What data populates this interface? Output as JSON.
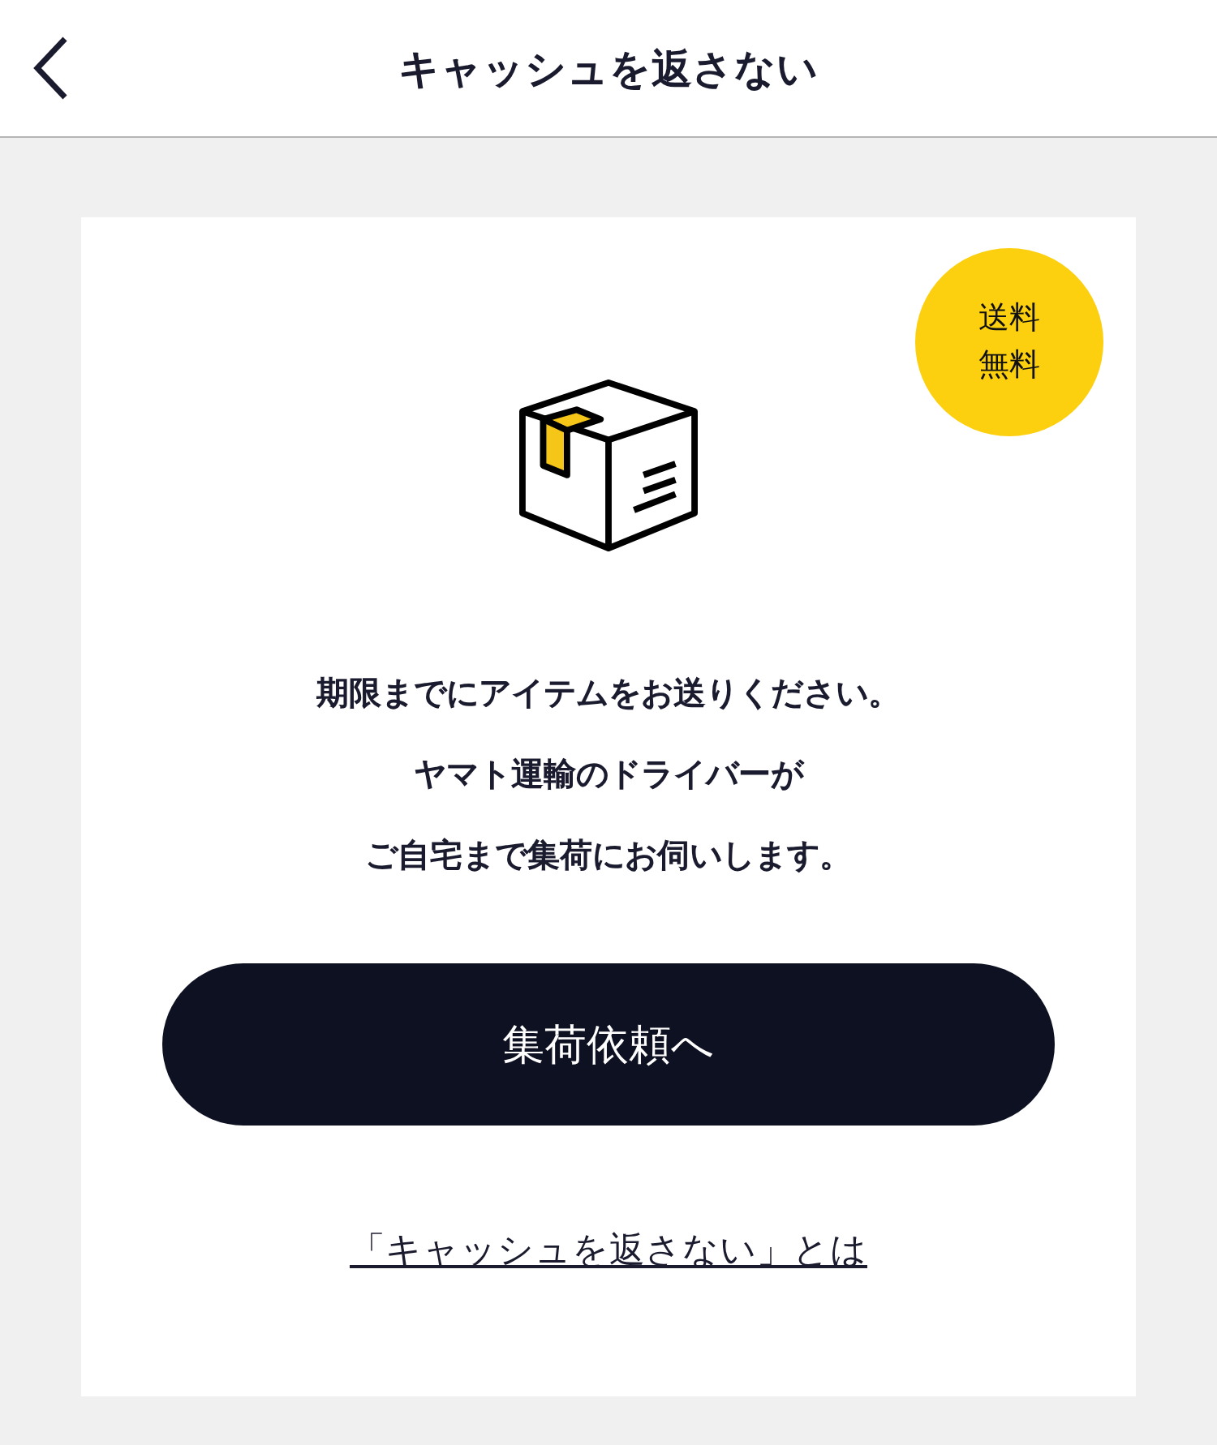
{
  "header": {
    "title": "キャッシュを返さない"
  },
  "badge": {
    "lines": [
      "送料",
      "無料"
    ]
  },
  "message": {
    "lines": [
      "期限までにアイテムをお送りください。",
      "ヤマト運輸のドライバーが",
      "ご自宅まで集荷にお伺いします。"
    ]
  },
  "primary_button": {
    "label": "集荷依頼へ"
  },
  "link": {
    "label": "「キャッシュを返さない」とは"
  }
}
